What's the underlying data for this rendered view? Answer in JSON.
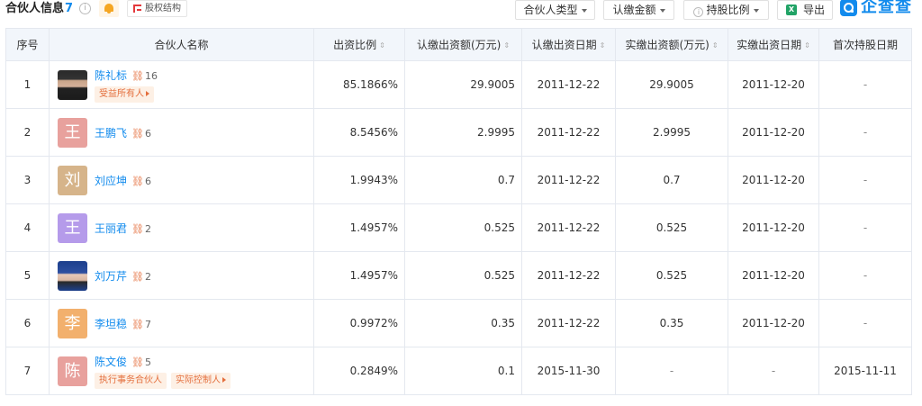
{
  "header": {
    "title": "合伙人信息",
    "count": "7",
    "equity_label": "股权结构",
    "filters": [
      {
        "label": "合伙人类型"
      },
      {
        "label": "认缴金额"
      },
      {
        "label": "持股比例"
      }
    ],
    "export_label": "导出",
    "logo_text": "企查查"
  },
  "columns": [
    "序号",
    "合伙人名称",
    "出资比例",
    "认缴出资额(万元)",
    "认缴出资日期",
    "实缴出资额(万元)",
    "实缴出资日期",
    "首次持股日期"
  ],
  "rows": [
    {
      "idx": "1",
      "avatar": "",
      "avatar_color": "photo1",
      "name": "陈礼标",
      "links": "16",
      "tags": [
        "受益所有人"
      ],
      "ratio": "85.1866%",
      "sub_amount": "29.9005",
      "sub_date": "2011-12-22",
      "paid_amount": "29.9005",
      "paid_date": "2011-12-20",
      "first_date": "-"
    },
    {
      "idx": "2",
      "avatar": "王",
      "avatar_color": "#e8a19d",
      "name": "王鹏飞",
      "links": "6",
      "tags": [],
      "ratio": "8.5456%",
      "sub_amount": "2.9995",
      "sub_date": "2011-12-22",
      "paid_amount": "2.9995",
      "paid_date": "2011-12-20",
      "first_date": "-"
    },
    {
      "idx": "3",
      "avatar": "刘",
      "avatar_color": "#d6b48a",
      "name": "刘应坤",
      "links": "6",
      "tags": [],
      "ratio": "1.9943%",
      "sub_amount": "0.7",
      "sub_date": "2011-12-22",
      "paid_amount": "0.7",
      "paid_date": "2011-12-20",
      "first_date": "-"
    },
    {
      "idx": "4",
      "avatar": "王",
      "avatar_color": "#b59bea",
      "name": "王丽君",
      "links": "2",
      "tags": [],
      "ratio": "1.4957%",
      "sub_amount": "0.525",
      "sub_date": "2011-12-22",
      "paid_amount": "0.525",
      "paid_date": "2011-12-20",
      "first_date": "-"
    },
    {
      "idx": "5",
      "avatar": "",
      "avatar_color": "photo2",
      "name": "刘万芹",
      "links": "2",
      "tags": [],
      "ratio": "1.4957%",
      "sub_amount": "0.525",
      "sub_date": "2011-12-22",
      "paid_amount": "0.525",
      "paid_date": "2011-12-20",
      "first_date": "-"
    },
    {
      "idx": "6",
      "avatar": "李",
      "avatar_color": "#f2b06d",
      "name": "李坦稳",
      "links": "7",
      "tags": [],
      "ratio": "0.9972%",
      "sub_amount": "0.35",
      "sub_date": "2011-12-22",
      "paid_amount": "0.35",
      "paid_date": "2011-12-20",
      "first_date": "-"
    },
    {
      "idx": "7",
      "avatar": "陈",
      "avatar_color": "#e8a19d",
      "name": "陈文俊",
      "links": "5",
      "tags": [
        "执行事务合伙人",
        "实际控制人"
      ],
      "ratio": "0.2849%",
      "sub_amount": "0.1",
      "sub_date": "2015-11-30",
      "paid_amount": "-",
      "paid_date": "-",
      "first_date": "2015-11-11"
    }
  ]
}
